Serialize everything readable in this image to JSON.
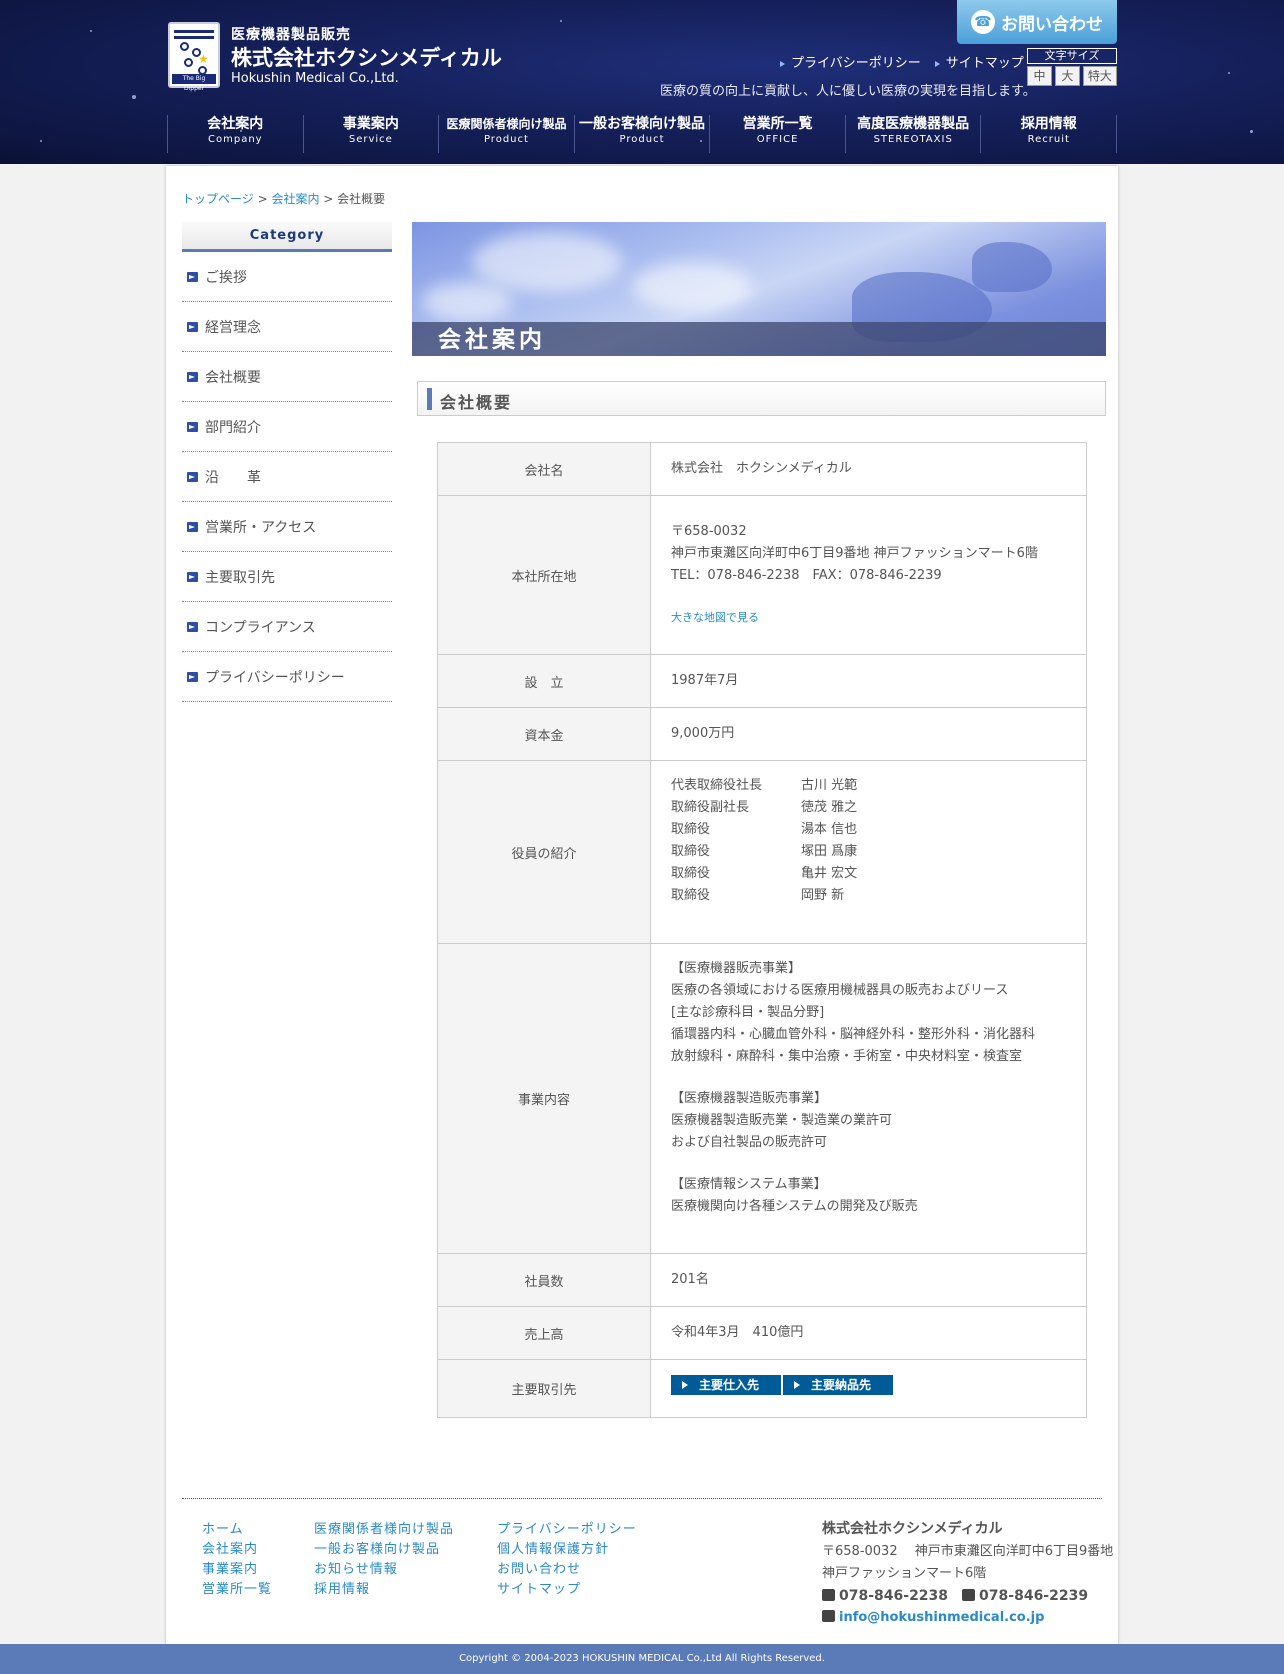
{
  "header": {
    "logo": {
      "line1": "医療機器製品販売",
      "line2": "株式会社ホクシンメディカル",
      "line3": "Hokushin Medical Co.,Ltd.",
      "mark_tag": "The Big Dipper"
    },
    "contact_label": "お問い合わせ",
    "toplinks": [
      "プライバシーポリシー",
      "サイトマップ"
    ],
    "font_size": {
      "title": "文字サイズ",
      "options": [
        "中",
        "大",
        "特大"
      ]
    },
    "tagline": "医療の質の向上に貢献し、人に優しい医療の実現を目指します。",
    "nav": [
      {
        "jp": "会社案内",
        "en": "Company"
      },
      {
        "jp": "事業案内",
        "en": "Service"
      },
      {
        "jp": "医療関係者様向け製品",
        "en": "Product"
      },
      {
        "jp": "一般お客様向け製品",
        "en": "Product"
      },
      {
        "jp": "営業所一覧",
        "en": "OFFICE"
      },
      {
        "jp": "高度医療機器製品",
        "en": "STEREOTAXIS"
      },
      {
        "jp": "採用情報",
        "en": "Recruit"
      }
    ]
  },
  "breadcrumb": {
    "home": "トップページ",
    "sep": " > ",
    "parent": "会社案内",
    "current": "会社概要"
  },
  "sidebar": {
    "title": "Category",
    "items": [
      "ご挨拶",
      "経営理念",
      "会社概要",
      "部門紹介",
      "沿　　革",
      "営業所・アクセス",
      "主要取引先",
      "コンプライアンス",
      "プライバシーポリシー"
    ]
  },
  "hero": {
    "title": "会社案内"
  },
  "section": {
    "title": "会社概要"
  },
  "table": {
    "company_name": {
      "label": "会社名",
      "value": "株式会社　ホクシンメディカル"
    },
    "address": {
      "label": "本社所在地",
      "zip": "〒658-0032",
      "addr": "神戸市東灘区向洋町中6丁目9番地 神戸ファッションマート6階",
      "tel": "TEL：078-846-2238　FAX：078-846-2239",
      "map_link": "大きな地図で見る"
    },
    "founded": {
      "label": "設　立",
      "value": "1987年7月"
    },
    "capital": {
      "label": "資本金",
      "value": "9,000万円"
    },
    "officers": {
      "label": "役員の紹介",
      "rows": [
        {
          "role": "代表取締役社長",
          "name": "古川 光範"
        },
        {
          "role": "取締役副社長",
          "name": "徳茂 雅之"
        },
        {
          "role": "取締役",
          "name": "湯本 信也"
        },
        {
          "role": "取締役",
          "name": "塚田 爲康"
        },
        {
          "role": "取締役",
          "name": "亀井 宏文"
        },
        {
          "role": "取締役",
          "name": "岡野 新"
        }
      ]
    },
    "business": {
      "label": "事業内容",
      "lines": [
        "【医療機器販売事業】",
        "医療の各領域における医療用機械器具の販売およびリース",
        "[主な診療科目・製品分野]",
        "循環器内科・心臓血管外科・脳神経外科・整形外科・消化器科",
        "放射線科・麻酔科・集中治療・手術室・中央材料室・検査室",
        "",
        "【医療機器製造販売事業】",
        "医療機器製造販売業・製造業の業許可",
        "および自社製品の販売許可",
        "",
        "【医療情報システム事業】",
        "医療機関向け各種システムの開発及び販売"
      ]
    },
    "employees": {
      "label": "社員数",
      "value": "201名"
    },
    "sales": {
      "label": "売上高",
      "value": "令和4年3月　410億円"
    },
    "partners": {
      "label": "主要取引先",
      "btn1": "主要仕入先",
      "btn2": "主要納品先"
    }
  },
  "footer": {
    "col1": [
      "ホーム",
      "会社案内",
      "事業案内",
      "営業所一覧"
    ],
    "col2": [
      "医療関係者様向け製品",
      "一般お客様向け製品",
      "お知らせ情報",
      "採用情報"
    ],
    "col3": [
      "プライバシーポリシー",
      "個人情報保護方針",
      "お問い合わせ",
      "サイトマップ"
    ],
    "company": {
      "name": "株式会社ホクシンメディカル",
      "addr1": "〒658-0032　 神戸市東灘区向洋町中6丁目9番地",
      "addr2": "神戸ファッションマート6階",
      "tel": "078-846-2238",
      "fax": "078-846-2239",
      "email": "info@hokushinmedical.co.jp"
    },
    "copyright": "Copyright © 2004-2023 HOKUSHIN MEDICAL Co.,Ltd All Rights Reserved."
  }
}
